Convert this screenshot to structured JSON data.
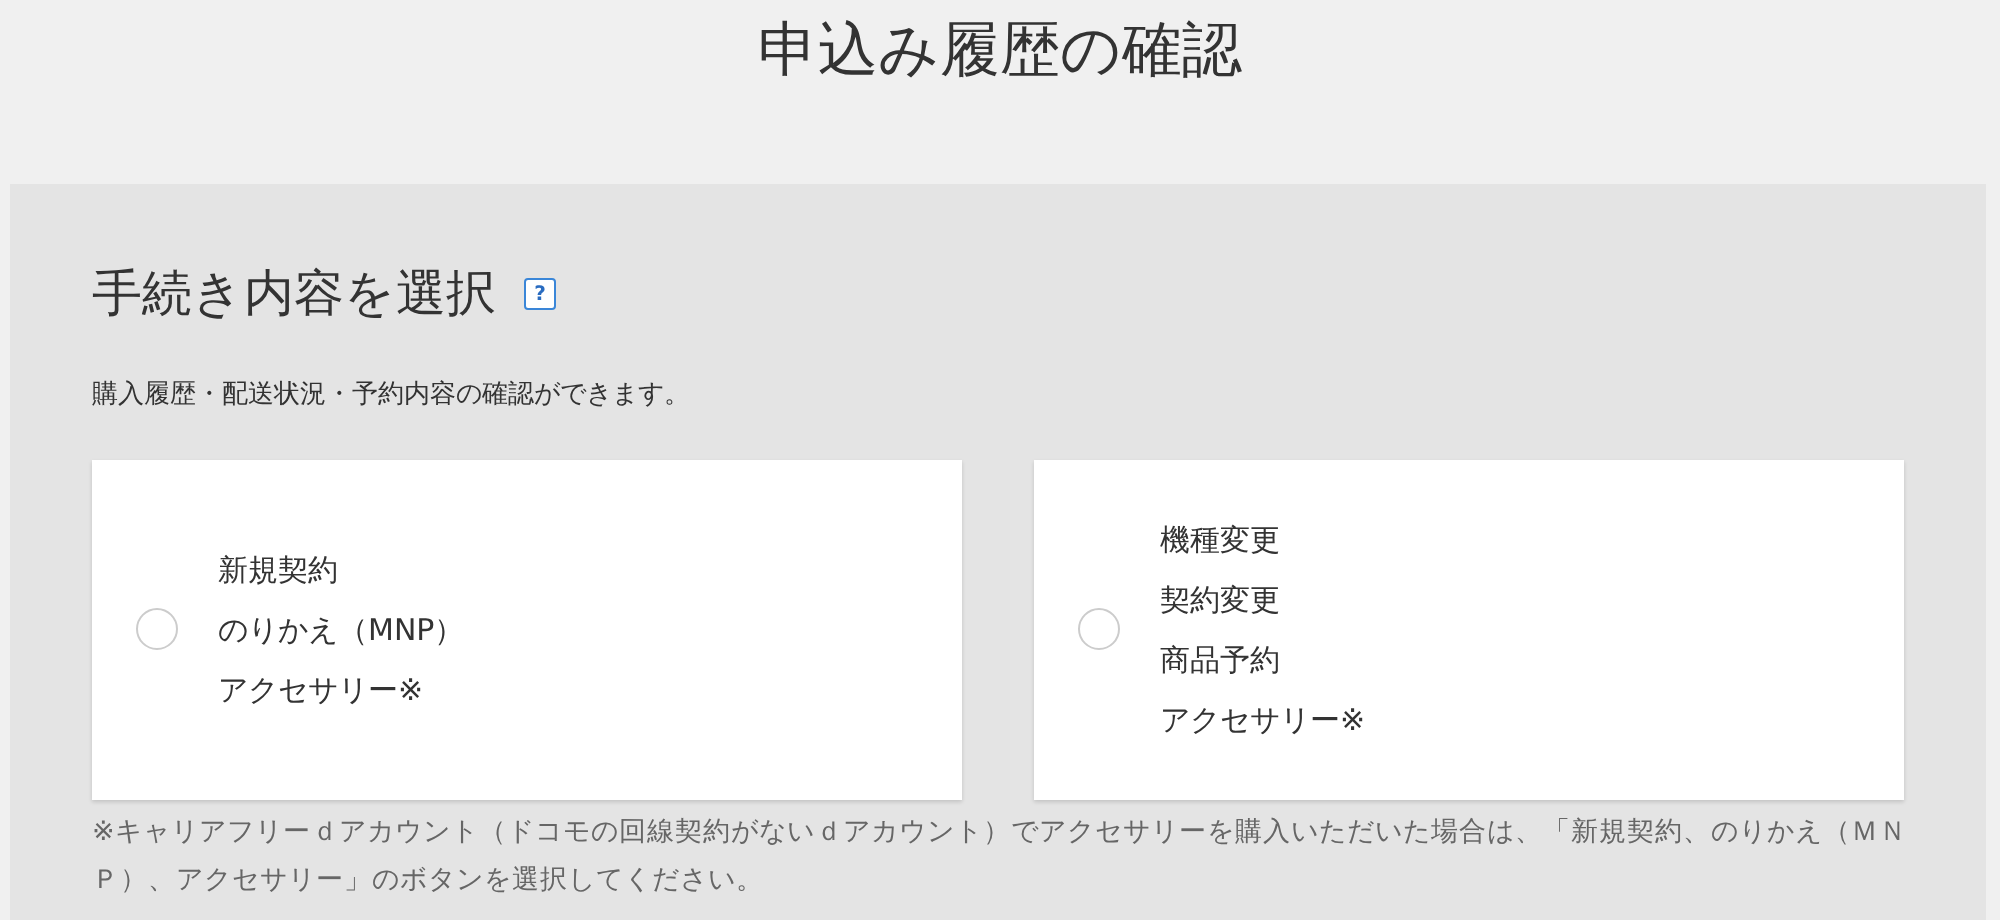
{
  "page_title": "申込み履歴の確認",
  "section": {
    "heading": "手続き内容を選択",
    "help": "?",
    "description": "購入履歴・配送状況・予約内容の確認ができます。",
    "options": [
      {
        "lines": [
          "新規契約",
          "のりかえ（MNP）",
          "アクセサリー※"
        ],
        "selected": false
      },
      {
        "lines": [
          "機種変更",
          "契約変更",
          "商品予約",
          "アクセサリー※"
        ],
        "selected": false
      }
    ],
    "note": "※キャリアフリーｄアカウント（ドコモの回線契約がないｄアカウント）でアクセサリーを購入いただいた場合は、「新規契約、のりかえ（ＭＮＰ）、アクセサリー」のボタンを選択してください。"
  }
}
